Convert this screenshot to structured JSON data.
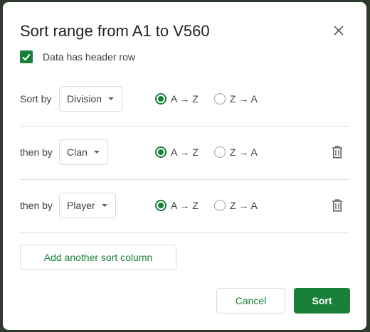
{
  "dialog": {
    "title": "Sort range from A1 to V560",
    "header_row_label": "Data has header row",
    "header_row_checked": true
  },
  "rows": [
    {
      "label": "Sort by",
      "column": "Division",
      "option_az": "A → Z",
      "option_za": "Z → A",
      "selected": "az"
    },
    {
      "label": "then by",
      "column": "Clan",
      "option_az": "A → Z",
      "option_za": "Z → A",
      "selected": "az"
    },
    {
      "label": "then by",
      "column": "Player",
      "option_az": "A → Z",
      "option_za": "Z → A",
      "selected": "az"
    }
  ],
  "buttons": {
    "add_column": "Add another sort column",
    "cancel": "Cancel",
    "sort": "Sort"
  },
  "colors": {
    "accent": "#188038",
    "background": "#2f3a2f"
  },
  "icons": {
    "close": "close-icon",
    "checkbox": "check-icon",
    "dropdown": "caret-down-icon",
    "delete": "trash-icon"
  }
}
